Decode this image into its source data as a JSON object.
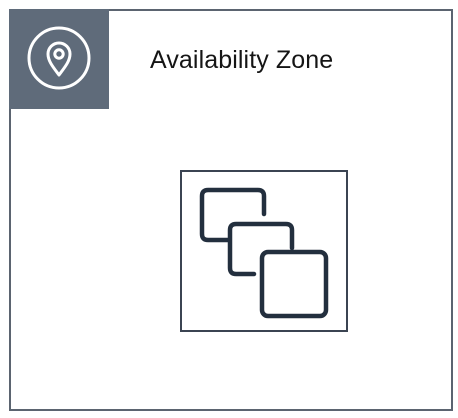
{
  "zone": {
    "title": "Availability Zone",
    "badge_icon": "location-pin-icon",
    "content_icon": "multiple-instances-icon",
    "colors": {
      "badge_background": "#5f6b7a",
      "frame_border": "#5b6470",
      "icon_stroke": "#232f3e",
      "badge_icon_stroke": "#ffffff"
    }
  }
}
